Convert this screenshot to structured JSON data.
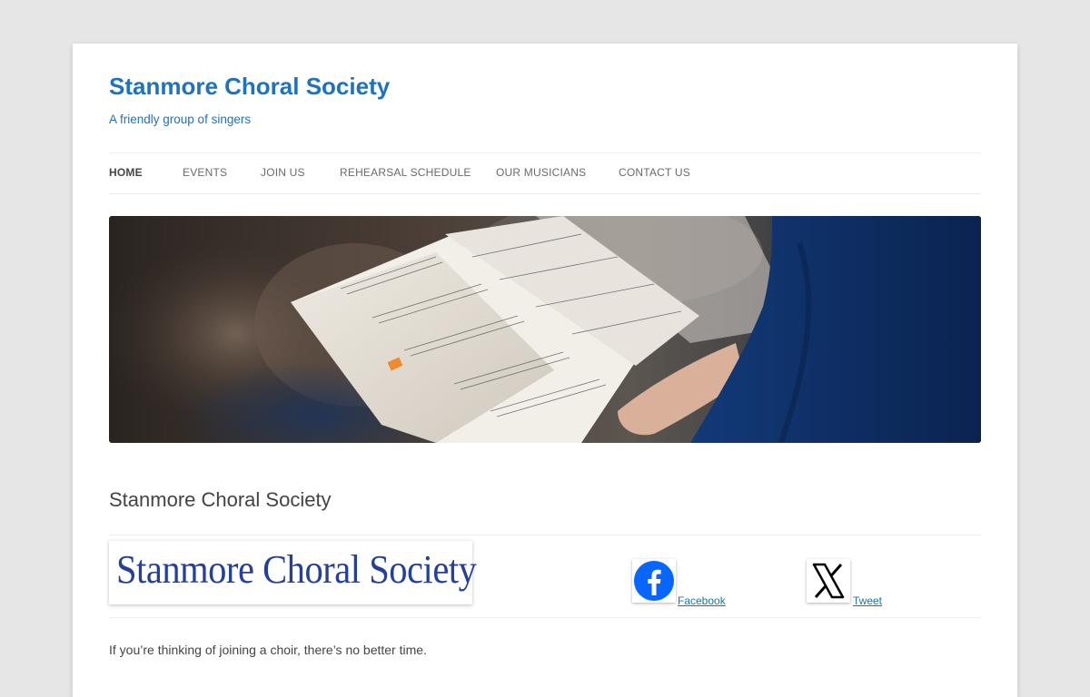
{
  "site": {
    "title": "Stanmore Choral Society",
    "tagline": "A friendly group of singers"
  },
  "nav": {
    "items": [
      {
        "label": "HOME",
        "active": true
      },
      {
        "label": "EVENTS",
        "active": false
      },
      {
        "label": "JOIN US",
        "active": false
      },
      {
        "label": "REHEARSAL SCHEDULE",
        "active": false
      },
      {
        "label": "OUR MUSICIANS",
        "active": false
      },
      {
        "label": "CONTACT US",
        "active": false
      }
    ]
  },
  "hero": {
    "description_icon": "choir-sheet-music-photo"
  },
  "content": {
    "page_title": "Stanmore Choral Society",
    "logo_text": "Stanmore Choral Society",
    "social": {
      "facebook_label": "Facebook",
      "tweet_label": "Tweet"
    },
    "intro": "If you’re thinking of joining a choir, there’s no better time."
  },
  "colors": {
    "accent": "#1e73be",
    "link": "#21759b",
    "logo": "#25409a",
    "facebook": "#0866ff"
  }
}
